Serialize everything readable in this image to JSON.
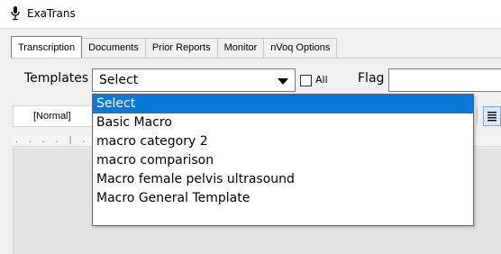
{
  "app": {
    "title": "ExaTrans",
    "icon": "microphone-icon"
  },
  "tabs": [
    {
      "label": "Transcription",
      "active": true
    },
    {
      "label": "Documents",
      "active": false
    },
    {
      "label": "Prior Reports",
      "active": false
    },
    {
      "label": "Monitor",
      "active": false
    },
    {
      "label": "nVoq Options",
      "active": false
    }
  ],
  "templates": {
    "label": "Templates",
    "selected": "Select",
    "all_label": "All",
    "all_checked": false,
    "options": [
      "Select",
      "Basic Macro",
      "macro category 2",
      "macro comparison",
      "Macro female pelvis ultrasound",
      "Macro General Template"
    ],
    "highlighted_index": 0
  },
  "flag": {
    "label": "Flag",
    "value": ""
  },
  "toolbar": {
    "style_value": "[Normal]",
    "align_icon": "align-justify-icon"
  },
  "ruler": {
    "marks": ". . . . | . . . . 1"
  },
  "colors": {
    "highlight": "#0a78d7",
    "window_bg": "#f0f0f0",
    "doc_bg": "#e3e3e3"
  }
}
